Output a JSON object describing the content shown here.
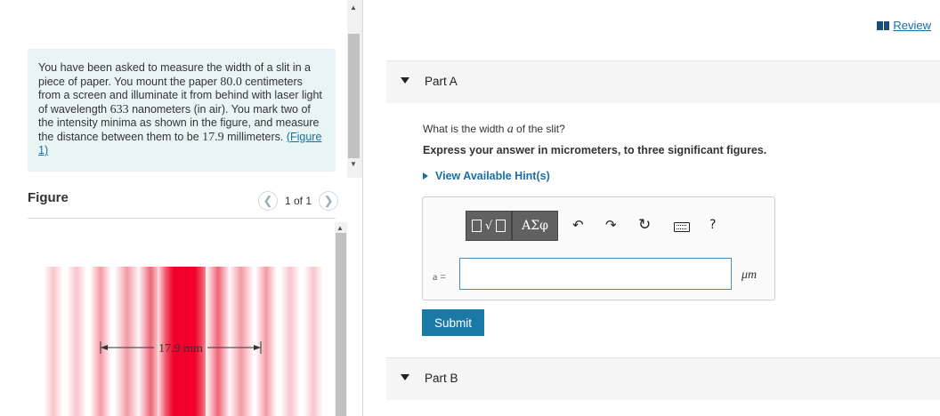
{
  "problem": {
    "text_1": "You have been asked to measure the width of a slit in a piece of paper. You mount the paper ",
    "paper_distance": "80.0",
    "text_2": " centimeters from a screen and illuminate it from behind with laser light of wavelength ",
    "wavelength": "633",
    "text_3": " nanometers (in air). You mark two of the intensity minima as shown in the figure, and measure the distance between them to be ",
    "minima_distance": "17.9",
    "text_4": " millimeters. ",
    "figure_link": "(Figure 1)"
  },
  "figure": {
    "label": "Figure",
    "pager_text": "1 of 1",
    "prev_icon": "chevron-left-icon",
    "next_icon": "chevron-right-icon",
    "dimension_label": "17.9 mm",
    "colors": {
      "dark_red": "#f0002a",
      "pale_red": "#f8c8d0"
    }
  },
  "review": {
    "label": "Review",
    "icon": "book-icon"
  },
  "part_a": {
    "label": "Part A",
    "question_pre": "What is the width ",
    "question_var": "a",
    "question_post": " of the slit?",
    "instruction": "Express your answer in micrometers, to three significant figures.",
    "hints_label": "View Available Hint(s)",
    "toolbar": {
      "templates_icon": "templates-icon",
      "greek_label": "ΑΣφ",
      "undo_icon": "undo-icon",
      "redo_icon": "redo-icon",
      "reset_icon": "reset-icon",
      "keyboard_icon": "keyboard-icon",
      "help_label": "?"
    },
    "answer_label": "a =",
    "answer_value": "",
    "unit": "μm",
    "submit_label": "Submit"
  },
  "part_b": {
    "label": "Part B"
  },
  "colors": {
    "accent": "#1a7aa5",
    "link": "#1a6ea8",
    "problem_bg": "#e9f5f5"
  }
}
